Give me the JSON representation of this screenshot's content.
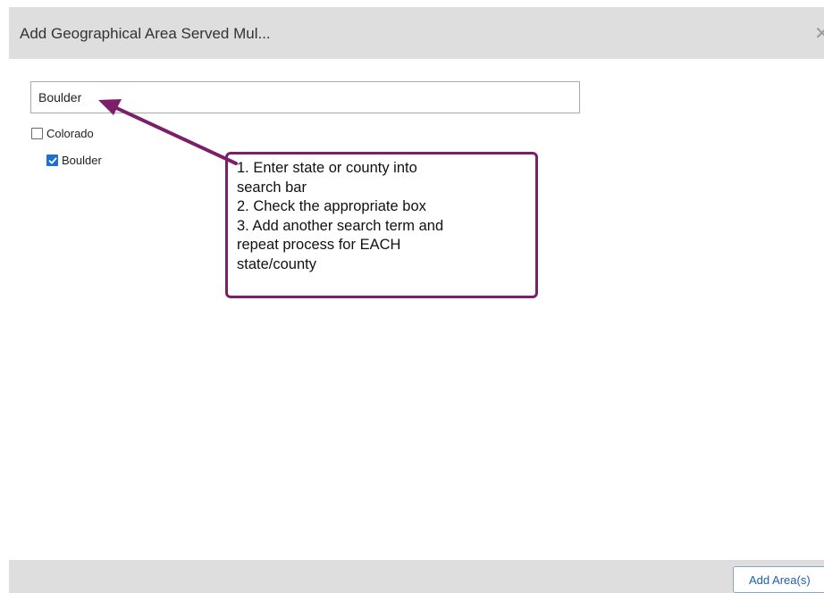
{
  "dialog": {
    "title": "Add Geographical Area Served Mul...",
    "close_icon": "close-icon"
  },
  "search": {
    "value": "Boulder",
    "placeholder": ""
  },
  "tree": {
    "items": [
      {
        "label": "Colorado",
        "checked": false
      },
      {
        "label": "Boulder",
        "checked": true
      }
    ]
  },
  "callout": {
    "lines": [
      "1. Enter state or county into",
      "search bar",
      "2. Check the appropriate box",
      "3. Add another search term and",
      "repeat process for EACH",
      "state/county"
    ],
    "border_color": "#7d1e6a"
  },
  "footer": {
    "add_button_label": "Add Area(s)"
  },
  "colors": {
    "header_bg": "#dedede",
    "accent": "#1f6fd1",
    "annotation": "#7d1e6a"
  }
}
